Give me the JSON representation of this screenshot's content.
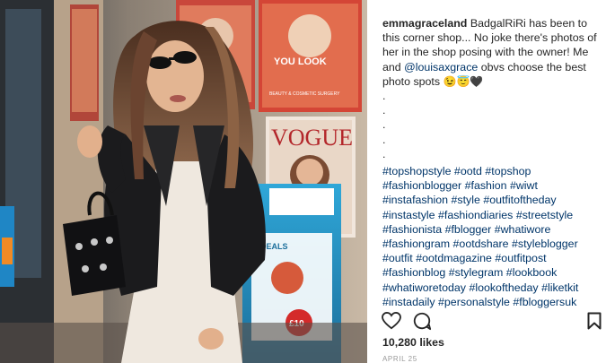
{
  "post": {
    "username": "emmagraceland",
    "caption_text": "BadgalRiRi has been to this corner shop... No joke there's photos of her in the shop posing with the owner! Me and",
    "mention": "@louisaxgrace",
    "caption_end": "obvs choose the best photo spots",
    "emojis": "😉😇🖤",
    "dots": [
      ".",
      ".",
      ".",
      ".",
      "."
    ],
    "hashtag_lines": [
      [
        "#topshopstyle",
        "#ootd",
        "#topshop"
      ],
      [
        "#fashionblogger",
        "#fashion",
        "#wiwt"
      ],
      [
        "#instafashion",
        "#style",
        "#outfitoftheday"
      ],
      [
        "#instastyle",
        "#fashiondiaries",
        "#streetstyle"
      ],
      [
        "#fashionista",
        "#fblogger",
        "#whatiwore"
      ],
      [
        "#fashiongram",
        "#ootdshare",
        "#styleblogger"
      ],
      [
        "#outfit",
        "#ootdmagazine",
        "#outfitpost"
      ],
      [
        "#fashionblog",
        "#stylegram",
        "#lookbook"
      ],
      [
        "#whatiworetoday",
        "#lookoftheday",
        "#liketkit"
      ],
      [
        "#instadaily",
        "#personalstyle",
        "#fbloggersuk"
      ]
    ],
    "likes": "10,280 likes",
    "date": "APRIL 25"
  },
  "photo": {
    "magazine_vogue": "VOGUE",
    "magazine_youlook": "YOU LOOK",
    "magazine_beauty": "BEAUTY & COSMETIC SURGERY",
    "stand_deals": "DEALS",
    "stand_price": "£10"
  },
  "icons": {
    "like": "heart-icon",
    "comment": "comment-icon",
    "save": "bookmark-icon"
  },
  "colors": {
    "hashtag": "#003569",
    "text": "#262626",
    "muted": "#999999"
  }
}
